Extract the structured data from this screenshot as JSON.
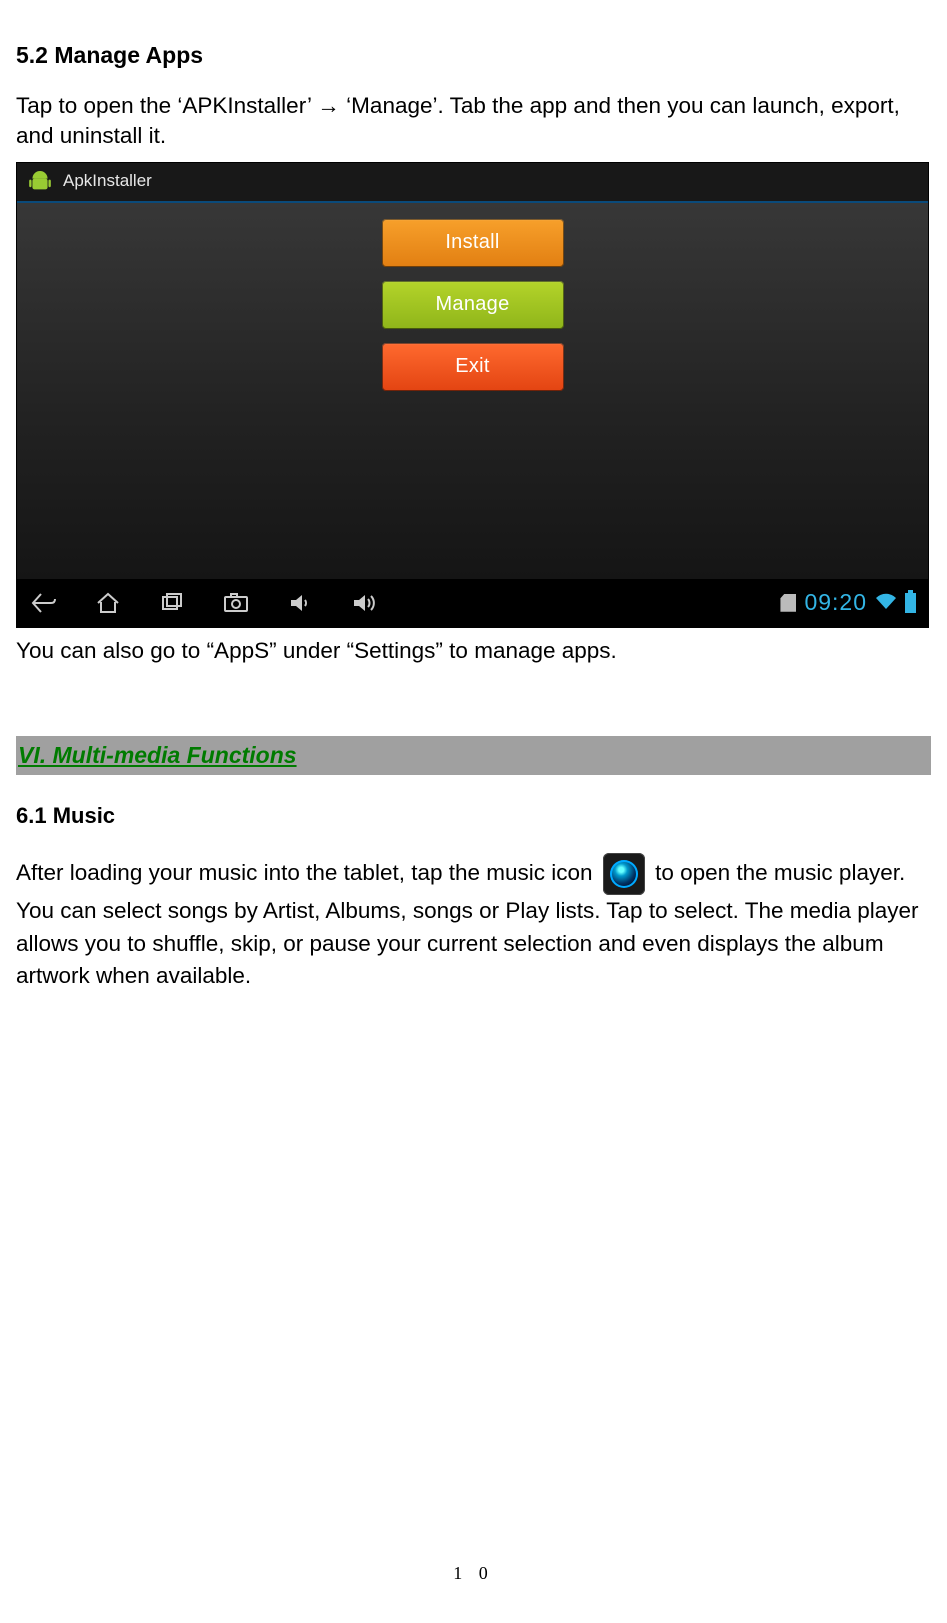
{
  "section52_title": "5.2 Manage Apps",
  "para52": "Tap to open the ‘APKInstaller’ → ‘Manage’. Tab the app and then you can launch, export, and uninstall it.",
  "screenshot": {
    "app_title": "ApkInstaller",
    "buttons": {
      "install": "Install",
      "manage": "Manage",
      "exit": "Exit"
    },
    "nav_icons": [
      "back",
      "home",
      "recent",
      "camera-screenshot",
      "volume-down",
      "volume-up"
    ],
    "status": {
      "time": "09:20"
    }
  },
  "para52b": "You can also go to “AppS” under “Settings” to manage apps.",
  "sectionVI_title": "VI. Multi-media Functions",
  "section61_title": "6.1 Music",
  "para61_a": "After loading your music into the tablet, tap the music icon ",
  "para61_b": " to open the music player. You can select songs by Artist, Albums, songs or Play lists. Tap to select. The media player allows you to shuffle, skip, or pause your current selection and even displays the album artwork when available.",
  "page_number": "1 0"
}
